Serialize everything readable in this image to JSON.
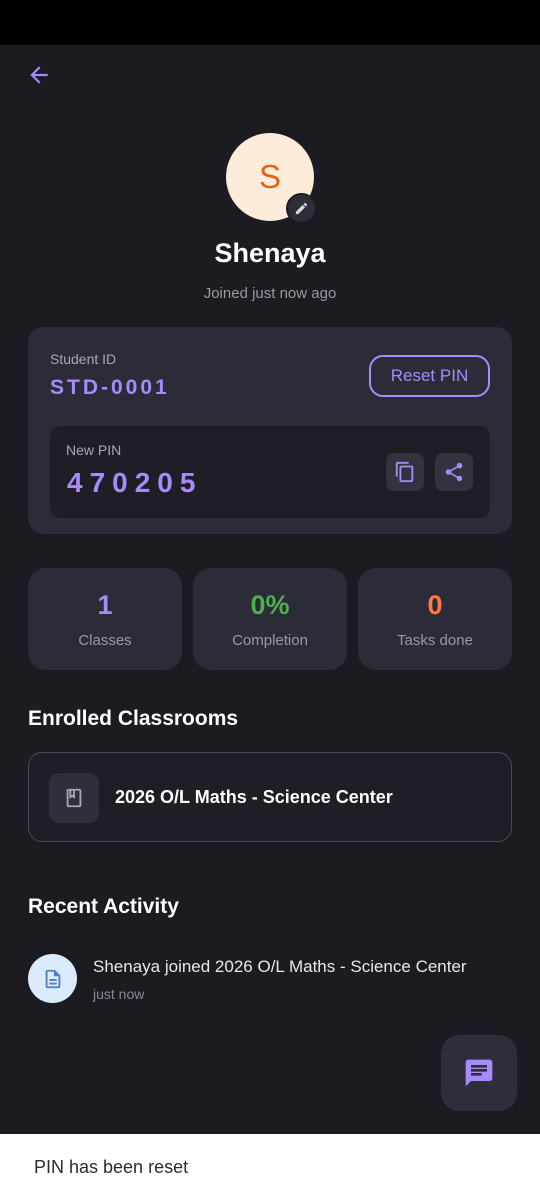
{
  "profile": {
    "initial": "S",
    "name": "Shenaya",
    "joined": "Joined just now ago"
  },
  "id_card": {
    "student_id_label": "Student ID",
    "student_id": "STD-0001",
    "reset_label": "Reset PIN",
    "pin_label": "New PIN",
    "pin": "470205"
  },
  "stats": [
    {
      "value": "1",
      "label": "Classes",
      "color": "#a78bfa"
    },
    {
      "value": "0%",
      "label": "Completion",
      "color": "#4caf50"
    },
    {
      "value": "0",
      "label": "Tasks done",
      "color": "#ff7a45"
    }
  ],
  "enrolled": {
    "title": "Enrolled Classrooms",
    "items": [
      {
        "name": "2026 O/L Maths - Science Center",
        "icon": "book-icon"
      }
    ]
  },
  "activity": {
    "title": "Recent Activity",
    "items": [
      {
        "text": "Shenaya joined 2026 O/L Maths - Science Center",
        "time": "just now",
        "icon": "document-icon"
      }
    ]
  },
  "snackbar": {
    "message": "PIN has been reset"
  },
  "colors": {
    "accent": "#a78bfa",
    "background": "#1c1b22",
    "card": "#2c2b38"
  }
}
